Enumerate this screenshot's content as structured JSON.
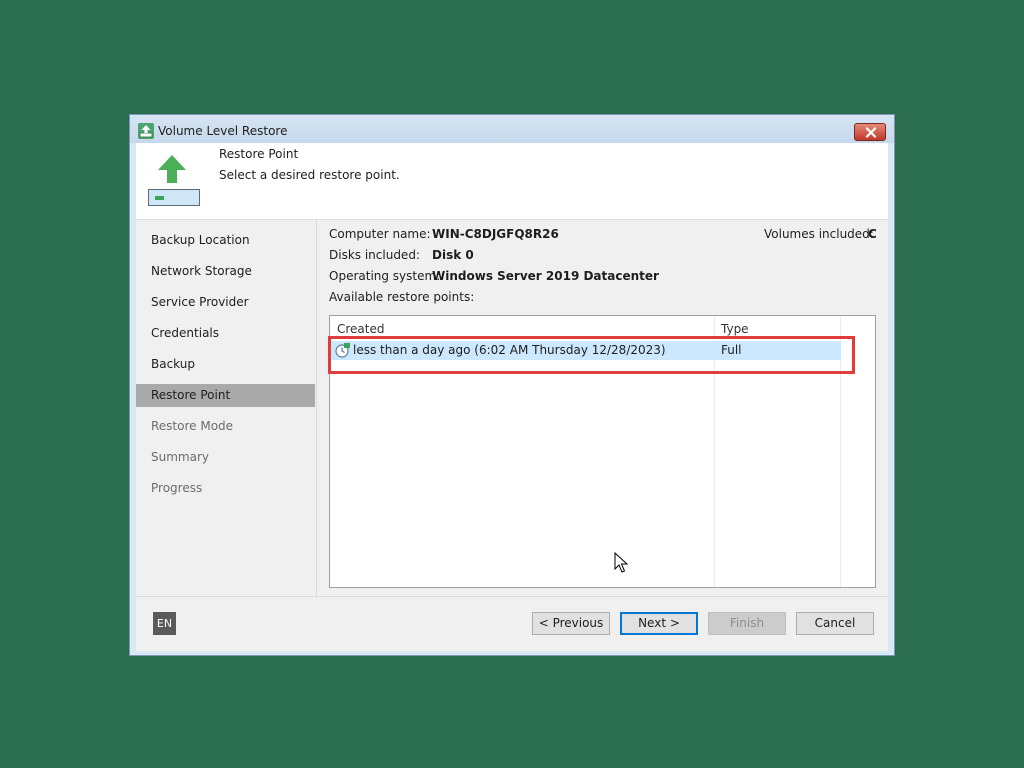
{
  "window": {
    "title": "Volume Level Restore",
    "header_title": "Restore Point",
    "header_subtitle": "Select a desired restore point."
  },
  "icons": {
    "app": "restore-app-icon",
    "close": "close-icon",
    "header": "upload-arrow-icon",
    "row": "restore-point-clock-icon"
  },
  "nav": {
    "items": [
      {
        "label": "Backup Location",
        "state": "normal"
      },
      {
        "label": "Network Storage",
        "state": "normal"
      },
      {
        "label": "Service Provider",
        "state": "normal"
      },
      {
        "label": "Credentials",
        "state": "normal"
      },
      {
        "label": "Backup",
        "state": "normal"
      },
      {
        "label": "Restore Point",
        "state": "selected"
      },
      {
        "label": "Restore Mode",
        "state": "disabled"
      },
      {
        "label": "Summary",
        "state": "disabled"
      },
      {
        "label": "Progress",
        "state": "disabled"
      }
    ]
  },
  "info": {
    "computer_label": "Computer name:",
    "computer_value": "WIN-C8DJGFQ8R26",
    "disks_label": "Disks included:",
    "disks_value": "Disk 0",
    "os_label": "Operating system:",
    "os_value": "Windows Server 2019 Datacenter",
    "volumes_label": "Volumes included:",
    "volumes_value": "C",
    "available_label": "Available restore points:"
  },
  "table": {
    "columns": [
      "Created",
      "Type"
    ],
    "rows": [
      {
        "created": "less than a day ago (6:02 AM Thursday 12/28/2023)",
        "type": "Full"
      }
    ]
  },
  "footer": {
    "lang": "EN",
    "previous": "< Previous",
    "next": "Next >",
    "finish": "Finish",
    "cancel": "Cancel"
  },
  "colors": {
    "desktop": "#2a6e4f",
    "selection": "#cce8ff",
    "highlight_box": "#e03c3c",
    "accent_green": "#3aa35a",
    "nav_selected": "#a9a9a9"
  }
}
